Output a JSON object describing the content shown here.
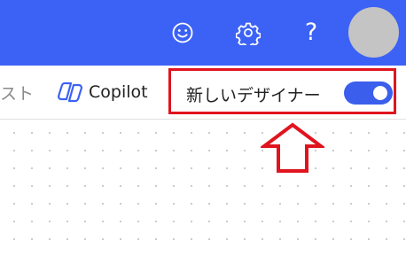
{
  "header": {
    "smiley_icon": "smiley-icon",
    "settings_icon": "gear-icon",
    "help_glyph": "?"
  },
  "toolbar": {
    "cutoff_text": "スト",
    "copilot_label": "Copilot",
    "new_designer_label": "新しいデザイナー",
    "new_designer_enabled": true
  },
  "colors": {
    "header_blue": "#3c62f5",
    "toggle_blue": "#3b5eec",
    "highlight_red": "#e0141e"
  }
}
